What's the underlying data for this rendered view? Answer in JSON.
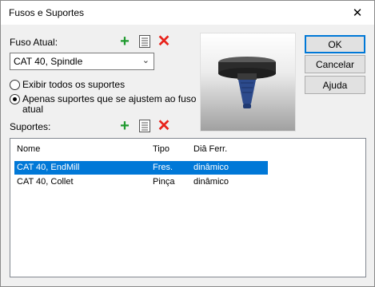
{
  "window": {
    "title": "Fusos e Suportes"
  },
  "current_spindle": {
    "label": "Fuso Atual:",
    "selected": "CAT 40, Spindle"
  },
  "filter": {
    "show_all": "Exibir todos os suportes",
    "fit_only_line1": "Apenas suportes que se ajustem ao fuso",
    "fit_only_line2": "atual",
    "selected_option": "fit_only"
  },
  "holders": {
    "label": "Suportes:",
    "columns": [
      "Nome",
      "Tipo",
      "Diâ Ferr."
    ],
    "rows": [
      {
        "name": "CAT 40, EndMill",
        "type": "Fres.",
        "diameter": "dinâmico",
        "selected": true
      },
      {
        "name": "CAT 40, Collet",
        "type": "Pinça",
        "diameter": "dinâmico",
        "selected": false
      }
    ]
  },
  "buttons": {
    "ok": "OK",
    "cancel": "Cancelar",
    "help": "Ajuda"
  },
  "icons": {
    "add": "plus-icon",
    "edit": "form-icon",
    "delete": "x-icon",
    "close": "close-icon"
  },
  "colors": {
    "add": "#1e9a2e",
    "delete": "#e8231b",
    "selection": "#0078d7",
    "default_button_border": "#0078d7",
    "spindle_body": "#2b2b2b",
    "spindle_taper": "#2c4a8c"
  }
}
